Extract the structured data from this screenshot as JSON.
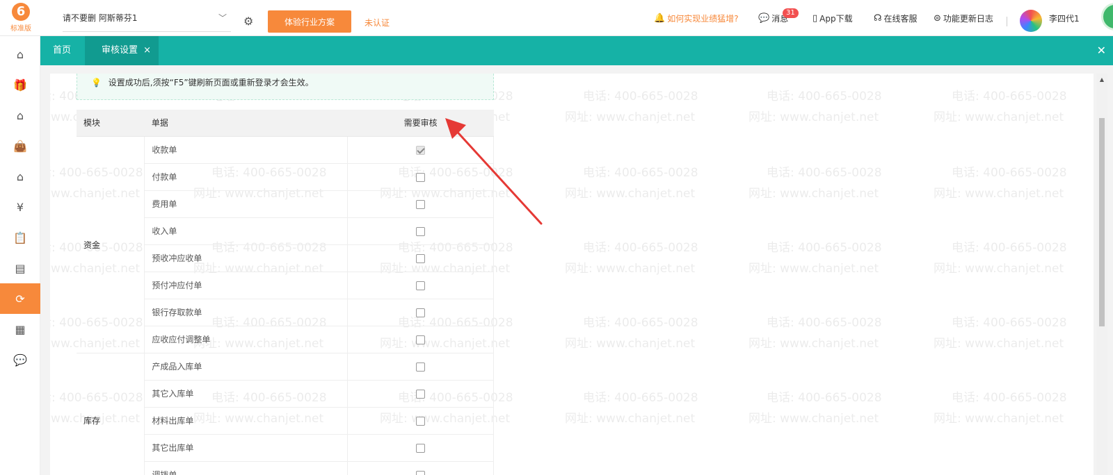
{
  "header": {
    "logo_text": "标准版",
    "logo_badge": "6",
    "account_name": "请不要删 阿斯蒂芬1",
    "trial_button": "体验行业方案",
    "unauth_label": "未认证",
    "performance_link": "如何实现业绩猛增?",
    "messages_label": "消息",
    "messages_badge": "31",
    "app_download": "App下载",
    "online_service": "在线客服",
    "changelog": "功能更新日志",
    "user_name": "李四代1"
  },
  "tabs": {
    "home": "首页",
    "current": "审核设置",
    "close_glyph": "×",
    "close_all_glyph": "✕"
  },
  "sidebar": {
    "items": [
      {
        "icon": "home-icon",
        "glyph": "⌂"
      },
      {
        "icon": "gift-icon",
        "glyph": "🎁"
      },
      {
        "icon": "store-icon",
        "glyph": "⌂"
      },
      {
        "icon": "bag-icon",
        "glyph": "👜"
      },
      {
        "icon": "warehouse-icon",
        "glyph": "⌂"
      },
      {
        "icon": "money-icon",
        "glyph": "¥"
      },
      {
        "icon": "clipboard-icon",
        "glyph": "📋"
      },
      {
        "icon": "report-icon",
        "glyph": "▤"
      },
      {
        "icon": "workflow-icon",
        "glyph": "⟳"
      },
      {
        "icon": "table-icon",
        "glyph": "▦"
      },
      {
        "icon": "chat-icon",
        "glyph": "💬"
      }
    ],
    "active_index": 8
  },
  "notice": "设置成功后,须按“F5”键刷新页面或重新登录才会生效。",
  "table": {
    "headers": {
      "module": "模块",
      "document": "单据",
      "need_review": "需要审核"
    },
    "groups": [
      {
        "module": "资金",
        "rows": [
          {
            "name": "收款单",
            "checked": true,
            "disabled": true
          },
          {
            "name": "付款单",
            "checked": false
          },
          {
            "name": "费用单",
            "checked": false
          },
          {
            "name": "收入单",
            "checked": false
          },
          {
            "name": "预收冲应收单",
            "checked": false
          },
          {
            "name": "预付冲应付单",
            "checked": false
          },
          {
            "name": "银行存取款单",
            "checked": false
          },
          {
            "name": "应收应付调整单",
            "checked": false
          }
        ]
      },
      {
        "module": "库存",
        "rows": [
          {
            "name": "产成品入库单",
            "checked": false
          },
          {
            "name": "其它入库单",
            "checked": false
          },
          {
            "name": "材料出库单",
            "checked": false
          },
          {
            "name": "其它出库单",
            "checked": false
          },
          {
            "name": "调拨单",
            "checked": false
          }
        ]
      }
    ]
  },
  "watermark": {
    "phone": "电话: 400-665-0028",
    "url": "网址: www.chanjet.net"
  },
  "colors": {
    "accent_orange": "#f7893b",
    "teal": "#16b2a6",
    "arrow_red": "#e53935"
  }
}
